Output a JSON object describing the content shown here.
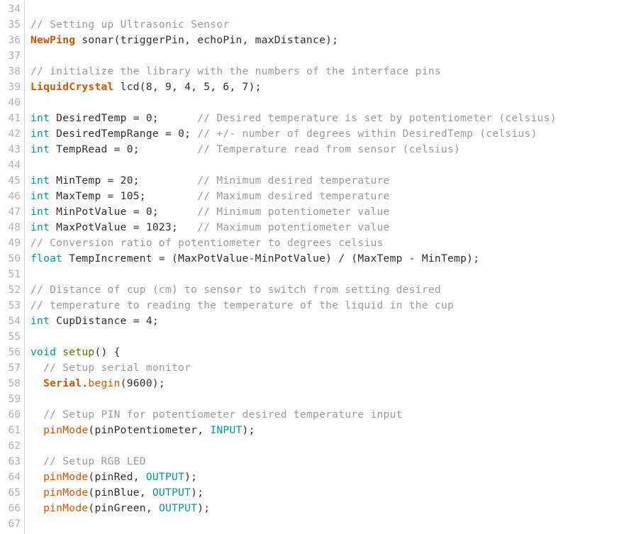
{
  "editor": {
    "name": "arduino-code-editor",
    "background_color": "#ffffff",
    "gutter_color": "#b0b0b0",
    "separator_color": "#d6d6d6",
    "first_line_number": 34,
    "last_line_number": 67,
    "palette": {
      "comment": "#9b9b9b",
      "datatype": "#00979c",
      "library": "#d35400",
      "function": "#d35400",
      "setup_loop": "#5e6d03",
      "constant": "#00979c",
      "plain_text": "#2f2f2f"
    }
  },
  "lines": [
    {
      "num": "34",
      "tokens": []
    },
    {
      "num": "35",
      "tokens": [
        {
          "t": "// Setting up Ultrasonic Sensor",
          "c": "tok-comment"
        }
      ]
    },
    {
      "num": "36",
      "tokens": [
        {
          "t": "NewPing",
          "c": "tok-lib"
        },
        {
          "t": " sonar(triggerPin, echoPin, maxDistance);",
          "c": "tok-plain"
        }
      ]
    },
    {
      "num": "37",
      "tokens": []
    },
    {
      "num": "38",
      "tokens": [
        {
          "t": "// initialize the library with the numbers of the interface pins",
          "c": "tok-comment"
        }
      ]
    },
    {
      "num": "39",
      "tokens": [
        {
          "t": "LiquidCrystal",
          "c": "tok-lib"
        },
        {
          "t": " lcd(8, 9, 4, 5, 6, 7);",
          "c": "tok-plain"
        }
      ]
    },
    {
      "num": "40",
      "tokens": []
    },
    {
      "num": "41",
      "tokens": [
        {
          "t": "int",
          "c": "tok-type"
        },
        {
          "t": " DesiredTemp = 0;      ",
          "c": "tok-plain"
        },
        {
          "t": "// Desired temperature is set by potentiometer (celsius)",
          "c": "tok-comment"
        }
      ]
    },
    {
      "num": "42",
      "tokens": [
        {
          "t": "int",
          "c": "tok-type"
        },
        {
          "t": " DesiredTempRange = 0; ",
          "c": "tok-plain"
        },
        {
          "t": "// +/- number of degrees within DesiredTemp (celsius)",
          "c": "tok-comment"
        }
      ]
    },
    {
      "num": "43",
      "tokens": [
        {
          "t": "int",
          "c": "tok-type"
        },
        {
          "t": " TempRead = 0;         ",
          "c": "tok-plain"
        },
        {
          "t": "// Temperature read from sensor (celsius)",
          "c": "tok-comment"
        }
      ]
    },
    {
      "num": "44",
      "tokens": []
    },
    {
      "num": "45",
      "tokens": [
        {
          "t": "int",
          "c": "tok-type"
        },
        {
          "t": " MinTemp = 20;         ",
          "c": "tok-plain"
        },
        {
          "t": "// Minimum desired temperature",
          "c": "tok-comment"
        }
      ]
    },
    {
      "num": "46",
      "tokens": [
        {
          "t": "int",
          "c": "tok-type"
        },
        {
          "t": " MaxTemp = 105;        ",
          "c": "tok-plain"
        },
        {
          "t": "// Maximum desired temperature",
          "c": "tok-comment"
        }
      ]
    },
    {
      "num": "47",
      "tokens": [
        {
          "t": "int",
          "c": "tok-type"
        },
        {
          "t": " MinPotValue = 0;      ",
          "c": "tok-plain"
        },
        {
          "t": "// Minimum potentiometer value",
          "c": "tok-comment"
        }
      ]
    },
    {
      "num": "48",
      "tokens": [
        {
          "t": "int",
          "c": "tok-type"
        },
        {
          "t": " MaxPotValue = 1023;   ",
          "c": "tok-plain"
        },
        {
          "t": "// Maximum potentiometer value",
          "c": "tok-comment"
        }
      ]
    },
    {
      "num": "49",
      "tokens": [
        {
          "t": "// Conversion ratio of potentiometer to degrees celsius",
          "c": "tok-comment"
        }
      ]
    },
    {
      "num": "50",
      "tokens": [
        {
          "t": "float",
          "c": "tok-type"
        },
        {
          "t": " TempIncrement = (MaxPotValue-MinPotValue) / (MaxTemp - MinTemp);",
          "c": "tok-plain"
        }
      ]
    },
    {
      "num": "51",
      "tokens": []
    },
    {
      "num": "52",
      "tokens": [
        {
          "t": "// Distance of cup (cm) to sensor to switch from setting desired",
          "c": "tok-comment"
        }
      ]
    },
    {
      "num": "53",
      "tokens": [
        {
          "t": "// temperature to reading the temperature of the liquid in the cup",
          "c": "tok-comment"
        }
      ]
    },
    {
      "num": "54",
      "tokens": [
        {
          "t": "int",
          "c": "tok-type"
        },
        {
          "t": " CupDistance = 4;",
          "c": "tok-plain"
        }
      ]
    },
    {
      "num": "55",
      "tokens": []
    },
    {
      "num": "56",
      "tokens": [
        {
          "t": "void",
          "c": "tok-type"
        },
        {
          "t": " ",
          "c": "tok-plain"
        },
        {
          "t": "setup",
          "c": "tok-setup"
        },
        {
          "t": "() {",
          "c": "tok-plain"
        }
      ]
    },
    {
      "num": "57",
      "tokens": [
        {
          "t": "  // Setup serial monitor",
          "c": "tok-comment"
        }
      ]
    },
    {
      "num": "58",
      "tokens": [
        {
          "t": "  ",
          "c": "tok-plain"
        },
        {
          "t": "Serial",
          "c": "tok-lib"
        },
        {
          "t": ".",
          "c": "tok-plain"
        },
        {
          "t": "begin",
          "c": "tok-func"
        },
        {
          "t": "(9600);",
          "c": "tok-plain"
        }
      ]
    },
    {
      "num": "59",
      "tokens": []
    },
    {
      "num": "60",
      "tokens": [
        {
          "t": "  // Setup PIN for potentiometer desired temperature input",
          "c": "tok-comment"
        }
      ]
    },
    {
      "num": "61",
      "tokens": [
        {
          "t": "  ",
          "c": "tok-plain"
        },
        {
          "t": "pinMode",
          "c": "tok-func"
        },
        {
          "t": "(pinPotentiometer, ",
          "c": "tok-plain"
        },
        {
          "t": "INPUT",
          "c": "tok-const"
        },
        {
          "t": ");",
          "c": "tok-plain"
        }
      ]
    },
    {
      "num": "62",
      "tokens": []
    },
    {
      "num": "63",
      "tokens": [
        {
          "t": "  // Setup RGB LED",
          "c": "tok-comment"
        }
      ]
    },
    {
      "num": "64",
      "tokens": [
        {
          "t": "  ",
          "c": "tok-plain"
        },
        {
          "t": "pinMode",
          "c": "tok-func"
        },
        {
          "t": "(pinRed, ",
          "c": "tok-plain"
        },
        {
          "t": "OUTPUT",
          "c": "tok-const"
        },
        {
          "t": ");",
          "c": "tok-plain"
        }
      ]
    },
    {
      "num": "65",
      "tokens": [
        {
          "t": "  ",
          "c": "tok-plain"
        },
        {
          "t": "pinMode",
          "c": "tok-func"
        },
        {
          "t": "(pinBlue, ",
          "c": "tok-plain"
        },
        {
          "t": "OUTPUT",
          "c": "tok-const"
        },
        {
          "t": ");",
          "c": "tok-plain"
        }
      ]
    },
    {
      "num": "66",
      "tokens": [
        {
          "t": "  ",
          "c": "tok-plain"
        },
        {
          "t": "pinMode",
          "c": "tok-func"
        },
        {
          "t": "(pinGreen, ",
          "c": "tok-plain"
        },
        {
          "t": "OUTPUT",
          "c": "tok-const"
        },
        {
          "t": ");",
          "c": "tok-plain"
        }
      ]
    },
    {
      "num": "67",
      "tokens": []
    }
  ]
}
